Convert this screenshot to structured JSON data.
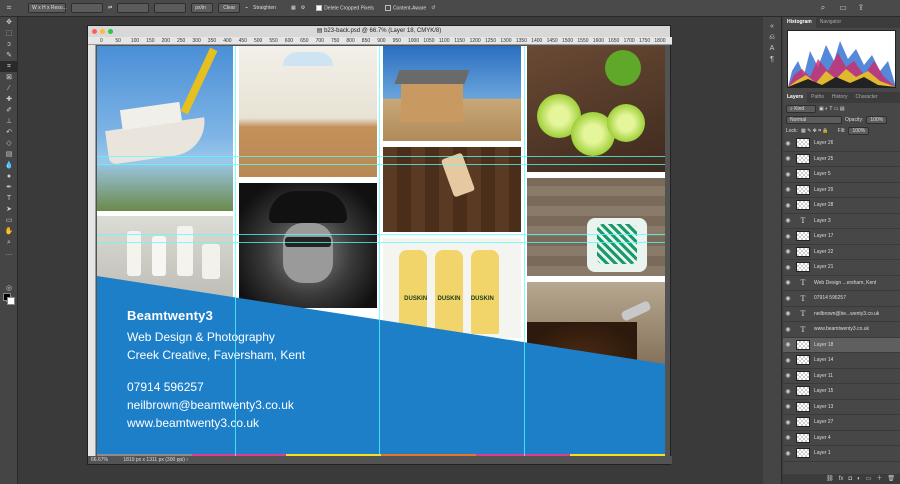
{
  "options_bar": {
    "ratio": "W x H x Reso...",
    "unit": "px/in",
    "clear": "Clear",
    "straighten": "Straighten",
    "delete_cropped": "Delete Cropped Pixels",
    "content_aware": "Content-Aware"
  },
  "document": {
    "title": "b23-back.psd @ 66.7% (Layer 18, CMYK/8)",
    "zoom": "66.67%",
    "doc_size": "1819 px x 1311 px (300 ppi)",
    "ruler_marks": [
      "0",
      "50",
      "100",
      "150",
      "200",
      "250",
      "300",
      "350",
      "400",
      "450",
      "500",
      "550",
      "600",
      "650",
      "700",
      "750",
      "800",
      "850",
      "900",
      "950",
      "1000",
      "1050",
      "1100",
      "1150",
      "1200",
      "1250",
      "1300",
      "1350",
      "1400",
      "1450",
      "1500",
      "1550",
      "1600",
      "1650",
      "1700",
      "1750",
      "1800"
    ]
  },
  "flyer": {
    "brand": "Beamtwenty3",
    "tagline1": "Web Design & Photography",
    "tagline2": "Creek Creative, Faversham, Kent",
    "phone": "07914 596257",
    "email": "neilbrown@beamtwenty3.co.uk",
    "website": "www.beamtwenty3.co.uk",
    "bottle_label": "DUSKIN",
    "accent": "#1e7fc9",
    "band_colors": [
      "#8c8c8c",
      "#e03c8f",
      "#f5e11e",
      "#e8732a",
      "#e03c8f",
      "#f5e11e"
    ]
  },
  "panels": {
    "histogram_tabs": [
      "Histogram",
      "Navigator"
    ],
    "layer_tabs": [
      "Layers",
      "Paths",
      "History",
      "Character"
    ],
    "kind": "Kind",
    "blend_mode": "Normal",
    "opacity_label": "Opacity:",
    "opacity": "100%",
    "lock_label": "Lock:",
    "fill_label": "Fill:",
    "fill": "100%",
    "layers": [
      {
        "name": "Layer 26",
        "type": "image"
      },
      {
        "name": "Layer 25",
        "type": "image"
      },
      {
        "name": "Layer 5",
        "type": "image"
      },
      {
        "name": "Layer 29",
        "type": "image"
      },
      {
        "name": "Layer 28",
        "type": "image"
      },
      {
        "name": "Layer 3",
        "type": "text"
      },
      {
        "name": "Layer 17",
        "type": "image"
      },
      {
        "name": "Layer 22",
        "type": "image"
      },
      {
        "name": "Layer 21",
        "type": "image"
      },
      {
        "name": "Web Design ...ersham, Kent",
        "type": "text"
      },
      {
        "name": "07914 596257",
        "type": "text"
      },
      {
        "name": "neilbrown@be...wenty3.co.uk",
        "type": "text"
      },
      {
        "name": "www.beamtwenty3.co.uk",
        "type": "text"
      },
      {
        "name": "Layer 18",
        "type": "image",
        "selected": true
      },
      {
        "name": "Layer 14",
        "type": "image"
      },
      {
        "name": "Layer 11",
        "type": "image"
      },
      {
        "name": "Layer 15",
        "type": "image"
      },
      {
        "name": "Layer 13",
        "type": "image"
      },
      {
        "name": "Layer 27",
        "type": "image"
      },
      {
        "name": "Layer 4",
        "type": "image"
      },
      {
        "name": "Layer 1",
        "type": "image"
      }
    ]
  }
}
